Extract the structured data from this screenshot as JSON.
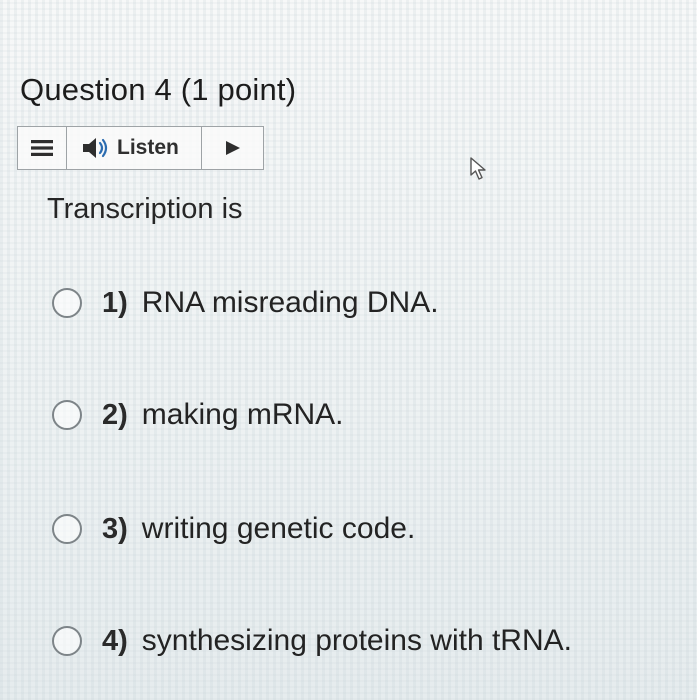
{
  "question": {
    "title": "Question 4 (1 point)",
    "prompt": "Transcription is"
  },
  "toolbar": {
    "menu_icon": "menu-icon",
    "speaker_icon": "speaker-icon",
    "listen_label": "Listen",
    "play_icon": "play-icon"
  },
  "options": [
    {
      "number": "1)",
      "text": "RNA misreading DNA."
    },
    {
      "number": "2)",
      "text": "making mRNA."
    },
    {
      "number": "3)",
      "text": "writing genetic code."
    },
    {
      "number": "4)",
      "text": "synthesizing proteins with tRNA."
    }
  ],
  "colors": {
    "text": "#222222",
    "border": "#9ea3a6",
    "speaker_accent": "#2b6cb0"
  }
}
